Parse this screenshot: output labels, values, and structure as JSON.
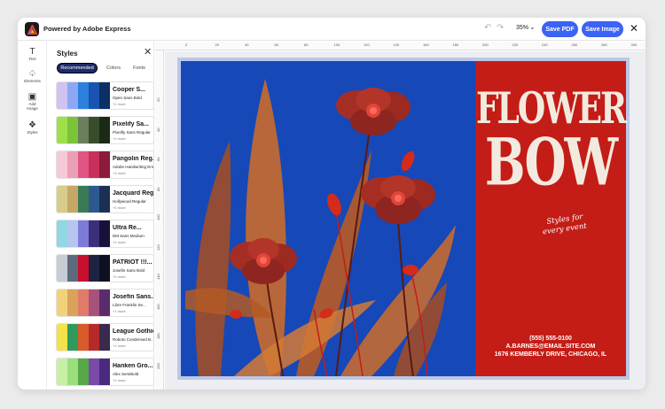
{
  "topbar": {
    "brand": "Powered by Adobe Express",
    "zoom": "35%",
    "save_pdf": "Save PDF",
    "save_image": "Save Image"
  },
  "rail": {
    "items": [
      {
        "label": "Text",
        "icon": "text-icon"
      },
      {
        "label": "Elements",
        "icon": "elements-icon"
      },
      {
        "label": "Add Image",
        "icon": "add-image-icon"
      },
      {
        "label": "Styles",
        "icon": "styles-icon"
      }
    ]
  },
  "panel": {
    "title": "Styles",
    "tabs": [
      "Recommended",
      "Colors",
      "Fonts"
    ],
    "cards": [
      {
        "font": "Cooper S...",
        "sub": "Open Sans Bold",
        "more": "+1 more",
        "colors": [
          "#cfc3f2",
          "#8da8f2",
          "#2d7fe0",
          "#1854b0",
          "#0b2f66"
        ]
      },
      {
        "font": "Pixelify Sa...",
        "sub": "Pixelify Sans Regular",
        "more": "+1 more",
        "colors": [
          "#9ee04a",
          "#7cc23a",
          "#6b7f5c",
          "#394d2c",
          "#1b2a17"
        ]
      },
      {
        "font": "Pangolin Reg...",
        "sub": "Adobe Handwriting Ernie",
        "more": "+1 more",
        "colors": [
          "#f6c9d6",
          "#ea9fb6",
          "#e05584",
          "#c8305c",
          "#8c1a3a"
        ]
      },
      {
        "font": "Jacquard Regular",
        "sub": "Hollywood Regular",
        "more": "+1 more",
        "colors": [
          "#d8cc8a",
          "#c7a766",
          "#3a7a56",
          "#2c5a8e",
          "#1c2f55"
        ]
      },
      {
        "font": "Ultra Re...",
        "sub": "DM Sans Medium",
        "more": "+1 more",
        "colors": [
          "#8fd8e4",
          "#b6c6f0",
          "#7d7ad8",
          "#3c2f7a",
          "#16123a"
        ]
      },
      {
        "font": "PATRIOT !!!...",
        "sub": "Josefin Sans Bold",
        "more": "+1 more",
        "colors": [
          "#c7cdd5",
          "#5e6b7c",
          "#c8102e",
          "#1d2340",
          "#0e1020"
        ]
      },
      {
        "font": "Josefin Sans...",
        "sub": "Libre Franklin Se...",
        "more": "+1 more",
        "colors": [
          "#f2d17a",
          "#d9a35c",
          "#e07a6a",
          "#a7527a",
          "#5a2c6e"
        ]
      },
      {
        "font": "League Gothic Regular",
        "sub": "Roboto Condensed B...",
        "more": "+1 more",
        "colors": [
          "#f4e24a",
          "#2f9a5c",
          "#d95a2a",
          "#b72a2a",
          "#3a2a4e"
        ]
      },
      {
        "font": "Hanken Gro...",
        "sub": "Alex SemiBold",
        "more": "+1 more",
        "colors": [
          "#c8efa6",
          "#9adf7c",
          "#57a848",
          "#7a4aa8",
          "#4a2a7e"
        ]
      }
    ]
  },
  "ruler": {
    "top": [
      "0",
      "20",
      "40",
      "60",
      "80",
      "100",
      "120",
      "140",
      "160",
      "180",
      "200",
      "220",
      "240",
      "260",
      "280",
      "300"
    ],
    "left": [
      "20",
      "40",
      "60",
      "80",
      "100",
      "120",
      "140",
      "160",
      "180",
      "200",
      "220"
    ]
  },
  "design": {
    "title_line1": "FLOWER",
    "title_line2": "BOW",
    "tagline1": "Styles for",
    "tagline2": "every event",
    "phone": "(555) 555-0100",
    "email": "A.BARNES@EMAIL.SITE.COM",
    "address": "1676 KEMBERLY DRIVE, CHICAGO, IL"
  },
  "colors": {
    "accent": "#3b63f5",
    "design_blue": "#1648b8",
    "design_red": "#c41c16"
  }
}
